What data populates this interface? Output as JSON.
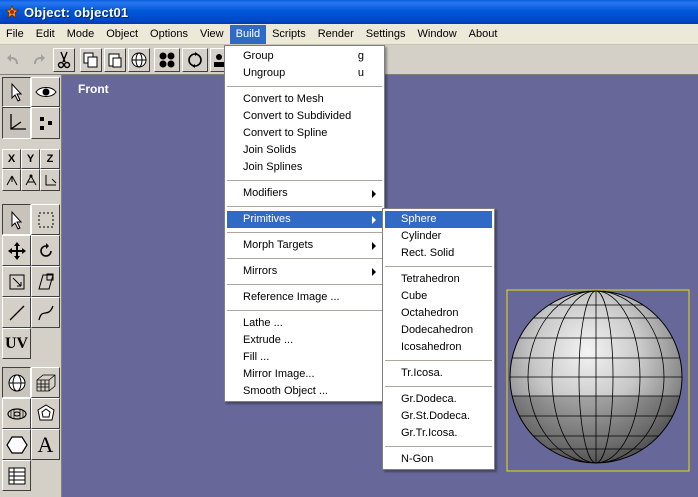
{
  "window": {
    "title": "Object: object01"
  },
  "menubar": {
    "items": [
      "File",
      "Edit",
      "Mode",
      "Object",
      "Options",
      "View",
      "Build",
      "Scripts",
      "Render",
      "Settings",
      "Window",
      "About"
    ],
    "active": "Build"
  },
  "viewport": {
    "label": "Front"
  },
  "palette": {
    "x_label": "X",
    "y_label": "Y",
    "z_label": "Z",
    "uv_label": "UV",
    "text_label": "A"
  },
  "build_menu": {
    "group": {
      "label": "Group",
      "shortcut": "g"
    },
    "ungroup": {
      "label": "Ungroup",
      "shortcut": "u"
    },
    "convert_to_mesh": "Convert to Mesh",
    "convert_to_subdivided": "Convert to Subdivided",
    "convert_to_spline": "Convert to Spline",
    "join_solids": "Join Solids",
    "join_splines": "Join Splines",
    "modifiers": "Modifiers",
    "primitives": "Primitives",
    "morph_targets": "Morph Targets",
    "mirrors": "Mirrors",
    "reference_image": "Reference Image ...",
    "lathe": "Lathe ...",
    "extrude": "Extrude ...",
    "fill": "Fill ...",
    "mirror_image": "Mirror Image...",
    "smooth_object": "Smooth Object ..."
  },
  "primitives_menu": {
    "sphere": "Sphere",
    "cylinder": "Cylinder",
    "rect_solid": "Rect. Solid",
    "tetrahedron": "Tetrahedron",
    "cube": "Cube",
    "octahedron": "Octahedron",
    "dodecahedron": "Dodecahedron",
    "icosahedron": "Icosahedron",
    "tr_icosa": "Tr.Icosa.",
    "gr_dodeca": "Gr.Dodeca.",
    "gr_st_dodeca": "Gr.St.Dodeca.",
    "gr_tr_icosa": "Gr.Tr.Icosa.",
    "n_gon": "N-Gon"
  },
  "colors": {
    "viewport_bg": "#67679a",
    "menu_highlight": "#316ac5",
    "selection_box": "#e8e000"
  }
}
